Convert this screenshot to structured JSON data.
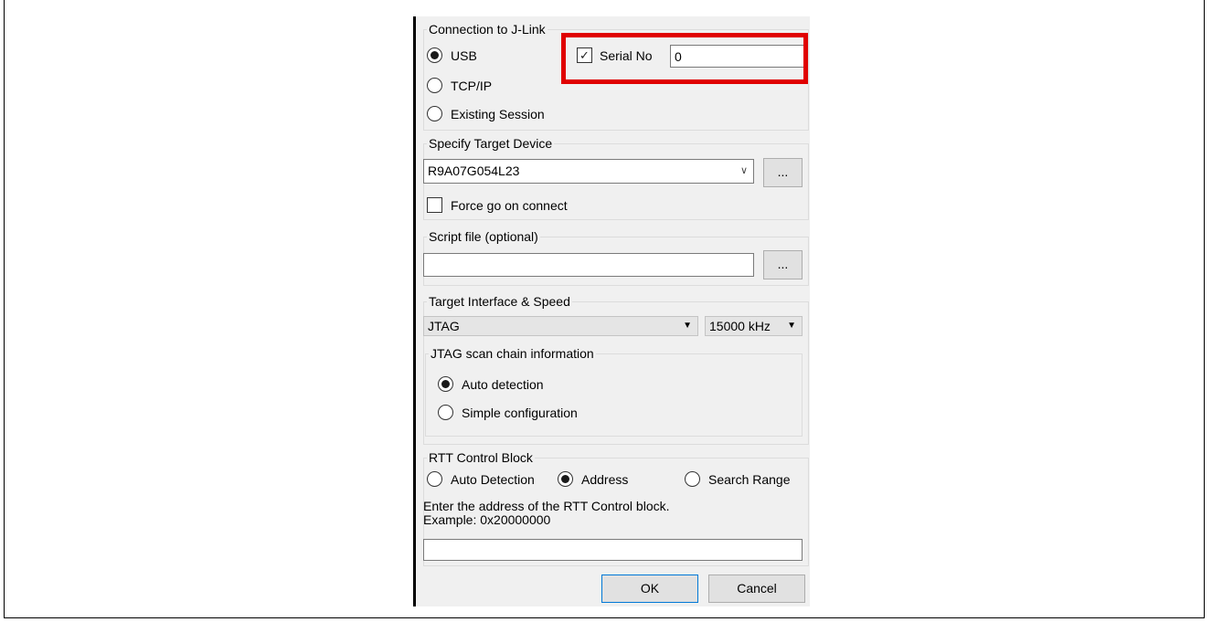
{
  "connection": {
    "legend": "Connection to J-Link",
    "options": [
      "USB",
      "TCP/IP",
      "Existing Session"
    ],
    "selected": "USB",
    "serial_label": "Serial No",
    "serial_checked": true,
    "serial_value": "0"
  },
  "target_device": {
    "legend": "Specify Target Device",
    "device": "R9A07G054L23",
    "browse_label": "...",
    "force_go_label": "Force go on connect",
    "force_go_checked": false
  },
  "script_file": {
    "legend": "Script file (optional)",
    "value": "",
    "browse_label": "..."
  },
  "interface": {
    "legend": "Target Interface & Speed",
    "interface": "JTAG",
    "speed": "15000 kHz",
    "scan_chain": {
      "legend": "JTAG scan chain information",
      "options": [
        "Auto detection",
        "Simple configuration"
      ],
      "selected": "Auto detection"
    }
  },
  "rtt": {
    "legend": "RTT Control Block",
    "options": [
      "Auto Detection",
      "Address",
      "Search Range"
    ],
    "selected": "Address",
    "hint_line1": "Enter the address of the RTT Control block.",
    "hint_line2": "Example: 0x20000000",
    "address_value": ""
  },
  "buttons": {
    "ok": "OK",
    "cancel": "Cancel"
  },
  "colors": {
    "highlight": "#e00000",
    "ok_border": "#0078d7"
  }
}
